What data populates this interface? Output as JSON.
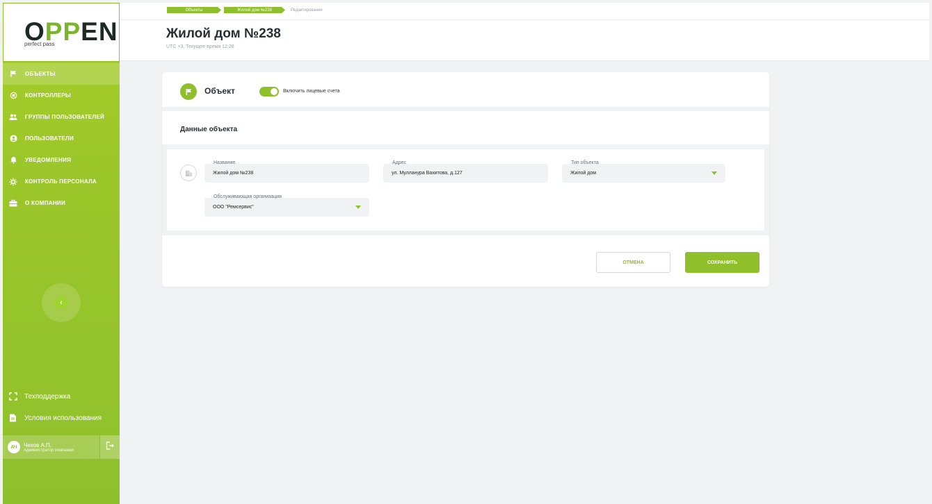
{
  "brand": {
    "logo_prefix": "O",
    "logo_highlight": "PP",
    "logo_suffix": "EN",
    "tagline": "perfect pass",
    "accent_color": "#8fc02c"
  },
  "sidebar": {
    "items": [
      {
        "label": "ОБЪЕКТЫ",
        "icon": "flag-icon",
        "active": true
      },
      {
        "label": "КОНТРОЛЛЕРЫ",
        "icon": "controller-icon"
      },
      {
        "label": "ГРУППЫ ПОЛЬЗОВАТЕЛЕЙ",
        "icon": "users-group-icon"
      },
      {
        "label": "ПОЛЬЗОВАТЕЛИ",
        "icon": "user-icon"
      },
      {
        "label": "УВЕДОМЛЕНИЯ",
        "icon": "bell-icon"
      },
      {
        "label": "КОНТРОЛЬ ПЕРСОНАЛА",
        "icon": "staff-control-icon"
      },
      {
        "label": "О КОМПАНИИ",
        "icon": "briefcase-icon"
      }
    ],
    "collapse_glyph": "‹",
    "support_label": "Техподдержка",
    "terms_label": "Условия использования",
    "user": {
      "initials": "АЧ",
      "name": "Чехов А.П.",
      "role": "Администратор компании"
    }
  },
  "header": {
    "breadcrumbs": [
      "Объекты",
      "Жилой дом №238"
    ],
    "breadcrumb_current": "Редактирование",
    "title": "Жилой дом №238",
    "subtitle": "UTC +3, Текущее время 12:28"
  },
  "card": {
    "title": "Объект",
    "toggle_label": "Включить лицевые счета",
    "toggle_on": true,
    "section_title": "Данные объекта",
    "fields": {
      "name": {
        "label": "Название",
        "value": "Жилой дом №238"
      },
      "address": {
        "label": "Адрес",
        "value": "ул. Мулланура Вахитова, д.127"
      },
      "type": {
        "label": "Тип объекта",
        "value": "Жилой дом"
      },
      "org": {
        "label": "Обслуживающая организация",
        "value": "ООО \"Ремсервис\""
      }
    },
    "cancel_label": "ОТМЕНА",
    "save_label": "СОХРАНИТЬ"
  }
}
